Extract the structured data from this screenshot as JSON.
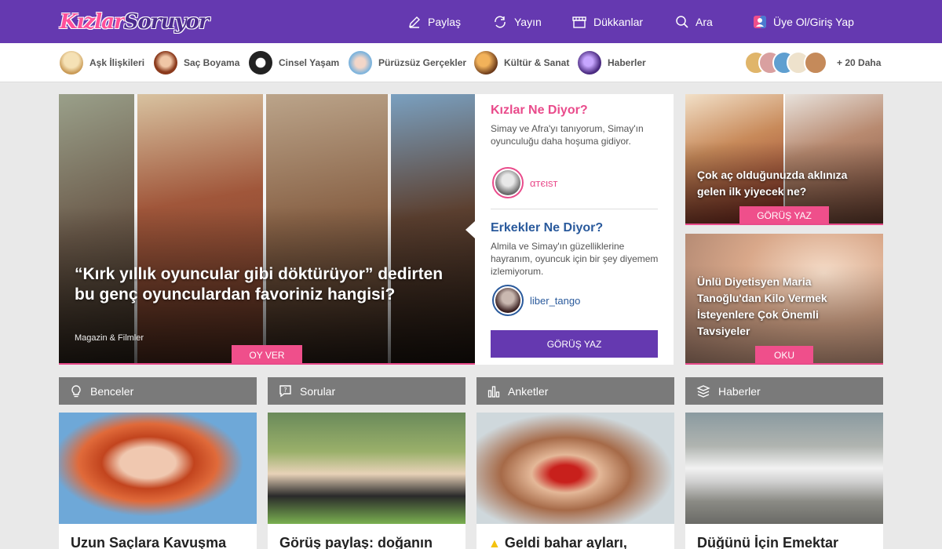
{
  "header": {
    "logo_part1": "Kızlar",
    "logo_part2": "Soruyor",
    "nav": [
      {
        "label": "Paylaş",
        "icon": "pencil-icon"
      },
      {
        "label": "Yayın",
        "icon": "refresh-icon"
      },
      {
        "label": "Dükkanlar",
        "icon": "shop-icon"
      },
      {
        "label": "Ara",
        "icon": "search-icon"
      },
      {
        "label": "Üye Ol/Giriş Yap",
        "icon": "user-gender-icon"
      }
    ]
  },
  "categories": {
    "items": [
      {
        "label": "Aşk İlişkileri",
        "color": "#e8c98a"
      },
      {
        "label": "Saç Boyama",
        "color": "#a0522d"
      },
      {
        "label": "Cinsel Yaşam",
        "color": "#222222"
      },
      {
        "label": "Pürüzsüz Gerçekler",
        "color": "#8fbfe0"
      },
      {
        "label": "Kültür & Sanat",
        "color": "#c57a3a"
      },
      {
        "label": "Haberler",
        "color": "#5a3a8a"
      }
    ],
    "more_label": "+ 20 Daha"
  },
  "hero": {
    "title": "“Kırk yıllık oyuncular gibi döktürüyor” dedirten bu genç oyunculardan favoriniz hangisi?",
    "category": "Magazin & Filmler",
    "button": "OY VER"
  },
  "opinions": {
    "women_title": "Kızlar Ne Diyor?",
    "women_text": "Simay ve Afra'yı tanıyorum, Simay'ın oyunculuğu daha hoşuma gidiyor.",
    "women_user": "αтєιѕт",
    "men_title": "Erkekler Ne Diyor?",
    "men_text": "Almila ve Simay'ın güzelliklerine hayranım, oyuncuk için bir şey diyemem izlemiyorum.",
    "men_user": "liber_tango",
    "button": "GÖRÜŞ YAZ"
  },
  "right_cards": [
    {
      "title": "Çok aç olduğunuzda aklınıza gelen ilk yiyecek ne?",
      "button": "GÖRÜŞ YAZ"
    },
    {
      "title": "Ünlü Diyetisyen Maria Tanoğlu'dan Kilo Vermek İsteyenlere Çok Önemli Tavsiyeler",
      "button": "OKU"
    }
  ],
  "sections": [
    {
      "label": "Benceler",
      "icon": "bulb-icon",
      "card_title": "Uzun Saçlara Kavuşma"
    },
    {
      "label": "Sorular",
      "icon": "question-bubble-icon",
      "card_title": "Görüş paylaş: doğanın"
    },
    {
      "label": "Anketler",
      "icon": "bar-chart-icon",
      "card_title": "Geldi bahar ayları,"
    },
    {
      "label": "Haberler",
      "icon": "news-stack-icon",
      "card_title": "Düğünü İçin Emektar"
    }
  ],
  "colors": {
    "brand": "#6539b0",
    "accent": "#ef4f8b",
    "women": "#e94b8b",
    "men": "#2a5a9c"
  }
}
